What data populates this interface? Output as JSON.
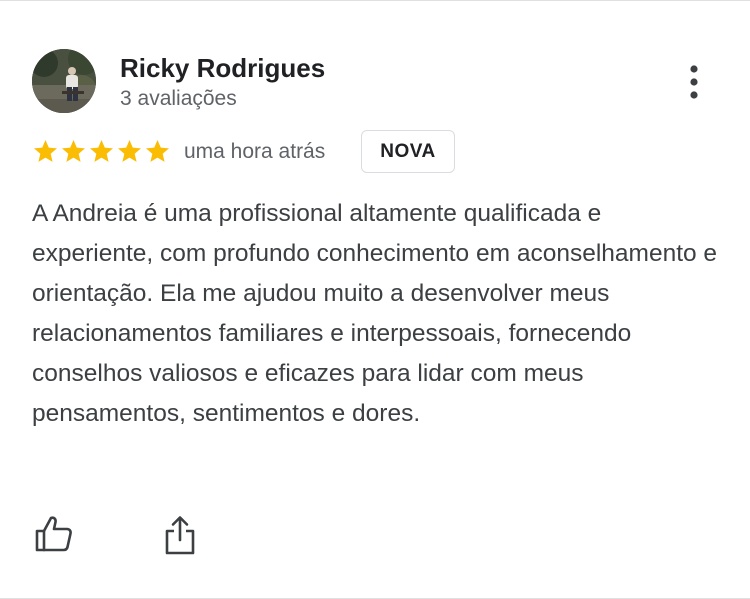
{
  "review": {
    "author_name": "Ricky Rodrigues",
    "author_reviews": "3 avaliações",
    "rating": 5,
    "max_rating": 5,
    "time_ago": "uma hora atrás",
    "badge": "NOVA",
    "text": "A Andreia é uma profissional altamente qualificada e experiente, com profundo conhecimento em aconselhamento e orientação. Ela me ajudou muito a desenvolver meus relacionamentos familiares e interpessoais, fornecendo conselhos valiosos e eficazes para lidar com meus pensamentos, sentimentos e dores."
  },
  "icons": {
    "more": "more-vert-icon",
    "like": "thumbs-up-icon",
    "share": "share-icon",
    "star": "star-icon"
  },
  "colors": {
    "star": "#fbbc04",
    "name": "#202124",
    "secondary_text": "#5f6368",
    "body_text": "#3c4043",
    "badge_border": "#dadce0"
  }
}
